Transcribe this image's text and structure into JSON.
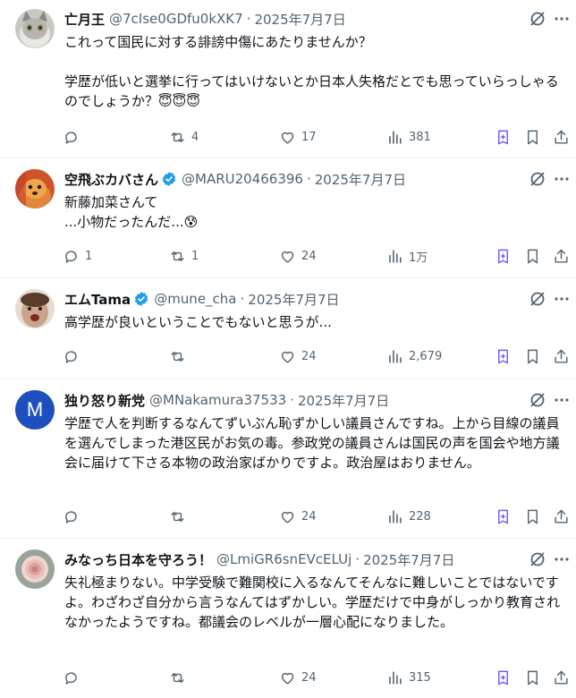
{
  "posts": [
    {
      "name": "亡月王",
      "verified": false,
      "handle": "@7cIse0GDfu0kXK7",
      "date": "2025年7月7日",
      "text": "これって国民に対する誹謗中傷にあたりませんか？\n\n学歴が低いと選挙に行ってはいけないとか日本人失格だとでも思っていらっしゃるのでしょうか？😇😇😇",
      "replies": "",
      "reposts": "4",
      "likes": "17",
      "views": "381",
      "avatar_icon": "cat-avatar"
    },
    {
      "name": "空飛ぶカバさん",
      "verified": true,
      "handle": "@MARU20466396",
      "date": "2025年7月7日",
      "text": "新藤加菜さんて\n...小物だったんだ...😰",
      "replies": "1",
      "reposts": "1",
      "likes": "24",
      "views": "1万",
      "avatar_icon": "dog-avatar"
    },
    {
      "name": "エムTama",
      "verified": true,
      "handle": "@mune_cha",
      "date": "2025年7月7日",
      "text": "高学歴が良いということでもないと思うが...",
      "replies": "",
      "reposts": "",
      "likes": "24",
      "views": "2,679",
      "avatar_icon": "face-avatar"
    },
    {
      "name": "独り怒り新党",
      "verified": false,
      "handle": "@MNakamura37533",
      "date": "2025年7月7日",
      "text": "学歴で人を判断するなんてずいぶん恥ずかしい議員さんですね。上から目線の議員を選んでしまった港区民がお気の毒。参政党の議員さんは国民の声を国会や地方議会に届けて下さる本物の政治家ばかりですよ。政治屋はおりません。",
      "replies": "",
      "reposts": "",
      "likes": "24",
      "views": "228",
      "avatar_letter": "M",
      "avatar_color": "#1e4fbf"
    },
    {
      "name": "みなっち日本を守ろう！",
      "verified": false,
      "handle": "@LmiGR6snEVcELUj",
      "date": "2025年7月7日",
      "text": "失礼極まりない。中学受験で難関校に入るなんてそんなに難しいことではないですよ。わざわざ自分から言うなんてはずかしい。学歴だけで中身がしっかり教育されなかったようですね。都議会のレベルが一層心配になりました。",
      "replies": "",
      "reposts": "",
      "likes": "24",
      "views": "315",
      "avatar_icon": "rose-avatar"
    }
  ],
  "colors": {
    "text": "#0f1419",
    "secondary": "#536471",
    "verified": "#1d9bf0",
    "grok": "#7856ff",
    "divider": "#eff3f4"
  }
}
